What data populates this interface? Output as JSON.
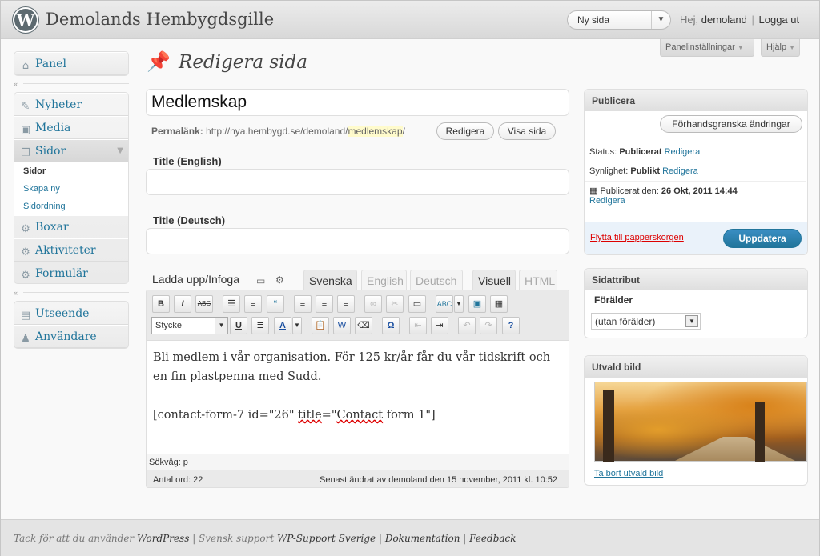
{
  "header": {
    "logo_glyph": "W",
    "site_title": "Demolands Hembygdsgille",
    "new_select": "Ny sida",
    "greeting_prefix": "Hej,",
    "username": "demoland",
    "logout": "Logga ut"
  },
  "screen_meta": {
    "panel_settings": "Panelinställningar",
    "help": "Hjälp"
  },
  "menu": {
    "panel": "Panel",
    "posts": "Nyheter",
    "media": "Media",
    "pages": "Sidor",
    "pages_sub": [
      "Sidor",
      "Skapa ny",
      "Sidordning"
    ],
    "boxes": "Boxar",
    "activities": "Aktiviteter",
    "forms": "Formulär",
    "appearance": "Utseende",
    "users": "Användare"
  },
  "page": {
    "title": "Redigera sida",
    "post_title": "Medlemskap",
    "permalink_label": "Permalänk:",
    "permalink_base": "http://nya.hembygd.se/demoland/",
    "permalink_slug": "medlemskap",
    "permalink_tail": "/",
    "edit_button": "Redigera",
    "view_button": "Visa sida",
    "title_english_label": "Title (English)",
    "title_english_value": "",
    "title_deutsch_label": "Title (Deutsch)",
    "title_deutsch_value": ""
  },
  "editor": {
    "upload_label": "Ladda upp/Infoga",
    "tabs": [
      "Svenska",
      "English",
      "Deutsch"
    ],
    "modes": [
      "Visuell",
      "HTML"
    ],
    "format_value": "Stycke",
    "content_p1": "Bli medlem i vår organisation. För 125 kr/år får du vår tidskrift och en fin plastpenna med Sudd.",
    "content_p2a": "[contact-form-7 id=\"26\" ",
    "content_p2b": "title",
    "content_p2c": "=\"",
    "content_p2d": "Contact",
    "content_p2e": " form 1\"]",
    "path": "Sökväg: p",
    "word_count": "Antal ord: 22",
    "last_edit": "Senast ändrat av demoland den 15 november, 2011 kl. 10:52"
  },
  "publish": {
    "title": "Publicera",
    "preview_button": "Förhandsgranska ändringar",
    "status_label": "Status:",
    "status_value": "Publicerat",
    "visibility_label": "Synlighet:",
    "visibility_value": "Publikt",
    "edit_link": "Redigera",
    "published_label": "Publicerat den:",
    "published_value": "26 Okt, 2011 14:44",
    "trash": "Flytta till papperskorgen",
    "update": "Uppdatera"
  },
  "page_attributes": {
    "title": "Sidattribut",
    "parent_label": "Förälder",
    "parent_value": "(utan förälder)"
  },
  "featured_image": {
    "title": "Utvald bild",
    "remove": "Ta bort utvald bild"
  },
  "footer": {
    "thanks": "Tack för att du använder",
    "wordpress": "WordPress",
    "sep1": " | Svensk support ",
    "support": "WP-Support Sverige",
    "sep2": " | ",
    "docs": "Dokumentation",
    "sep3": " | ",
    "feedback": "Feedback"
  },
  "colors": {
    "link": "#21759b",
    "update_button": "#21759b",
    "trash": "#dd0000"
  }
}
